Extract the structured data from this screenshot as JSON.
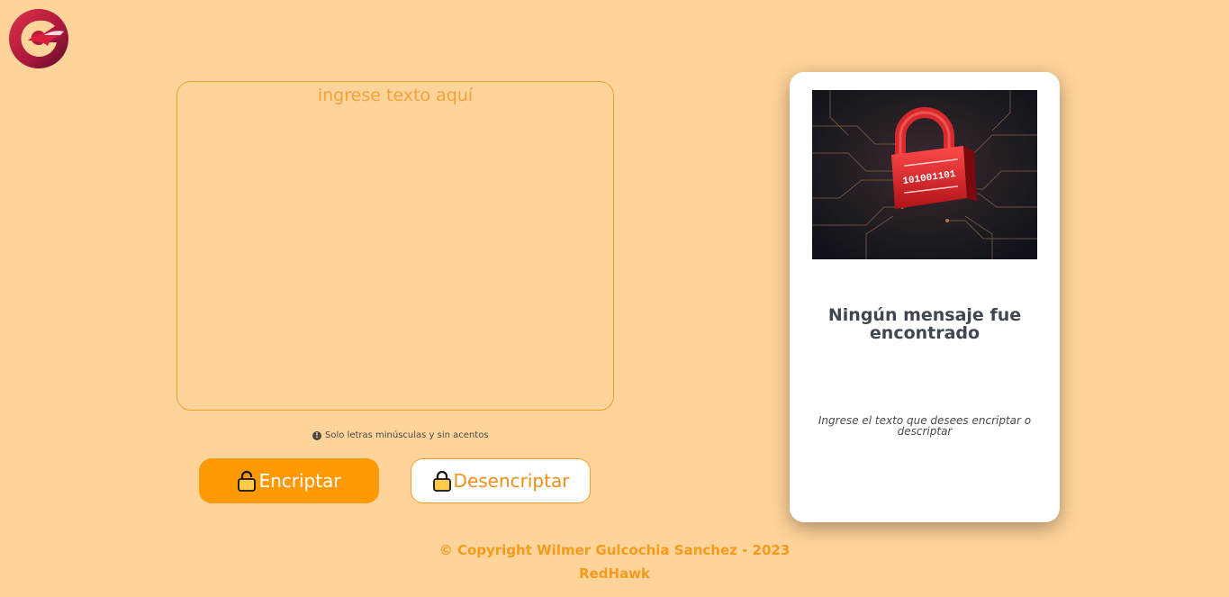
{
  "header": {
    "logo_icon": "redhawk-logo-icon"
  },
  "input": {
    "placeholder": "ingrese texto aquí",
    "value": ""
  },
  "hint": {
    "icon": "info-circle-icon",
    "text": "Solo letras minúsculas y sin acentos"
  },
  "actions": {
    "encrypt_label": "Encriptar",
    "encrypt_icon": "lock-open-icon",
    "decrypt_label": "Desencriptar",
    "decrypt_icon": "lock-icon"
  },
  "output": {
    "image_icon": "padlock-circuit-image",
    "title": "Ningún mensaje fue encontrado",
    "subtitle": "Ingrese el texto que desees encriptar o descriptar"
  },
  "footer": {
    "copyright": "© Copyright Wilmer Gulcochia Sanchez - 2023",
    "brand": "RedHawk"
  },
  "colors": {
    "background": "#ffd49a",
    "accent": "#ff9a05",
    "accent_text": "#f49b1e",
    "card": "#ffffff",
    "title": "#404652"
  }
}
